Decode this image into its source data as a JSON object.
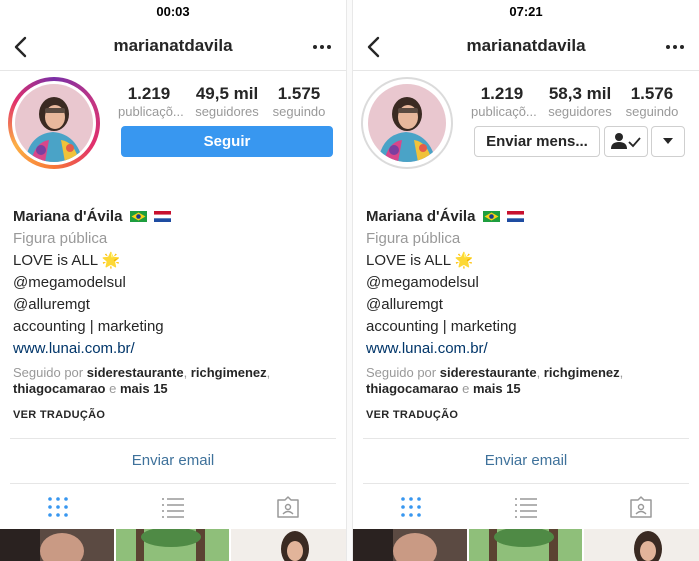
{
  "left": {
    "status_time": "00:03",
    "username": "marianatdavila",
    "stats": [
      {
        "value": "1.219",
        "label": "publicaçõ..."
      },
      {
        "value": "49,5 mil",
        "label": "seguidores"
      },
      {
        "value": "1.575",
        "label": "seguindo"
      }
    ],
    "follow_label": "Seguir"
  },
  "right": {
    "status_time": "07:21",
    "username": "marianatdavila",
    "stats": [
      {
        "value": "1.219",
        "label": "publicaçõ..."
      },
      {
        "value": "58,3 mil",
        "label": "seguidores"
      },
      {
        "value": "1.576",
        "label": "seguindo"
      }
    ],
    "message_label": "Enviar mens..."
  },
  "profile": {
    "name": "Mariana d'Ávila",
    "category": "Figura pública",
    "bio_lines": [
      "LOVE is ALL",
      "@megamodelsul",
      "@alluremgt",
      "accounting | marketing"
    ],
    "sparkle_emoji": "🌟",
    "website": "www.lunai.com.br/",
    "followed_by_prefix": "Seguido por ",
    "followed_by_users": [
      "siderestaurante",
      "richgimenez",
      "thiagocamarao"
    ],
    "followed_by_sep": ", ",
    "followed_by_and": " e ",
    "followed_by_more": "mais 15",
    "translate_label": "VER TRADUÇÃO",
    "email_label": "Enviar email"
  },
  "icons": {
    "back": "chevron-left-icon",
    "more": "more-horizontal-icon",
    "grid": "grid-icon",
    "list": "list-icon",
    "tagged": "tagged-icon",
    "following": "person-check-icon",
    "dropdown": "triangle-down-icon"
  },
  "colors": {
    "accent": "#3897f0",
    "link": "#003569",
    "email": "#3f729b",
    "muted": "#999999",
    "active_tab": "#3897f0",
    "inactive_tab": "#999999"
  }
}
